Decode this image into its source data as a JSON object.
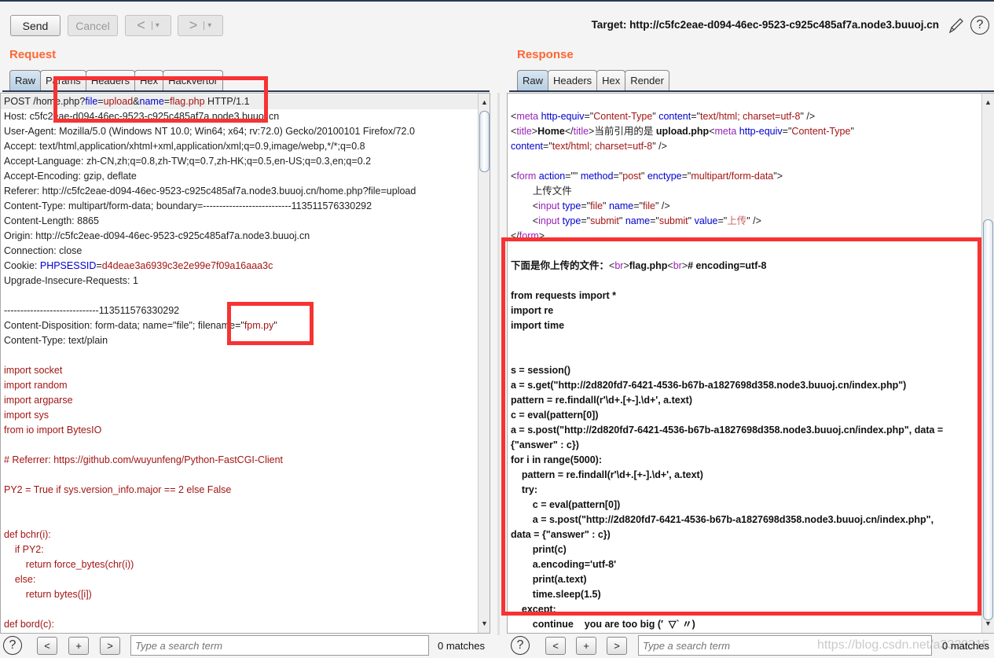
{
  "toolbar": {
    "send": "Send",
    "cancel": "Cancel",
    "back": "<",
    "back_menu": "▾",
    "forward": ">",
    "forward_menu": "▾",
    "target": "Target: http://c5fc2eae-d094-46ec-9523-c925c485af7a.node3.buuoj.cn",
    "edit_icon": "pencil-icon",
    "help_icon": "?"
  },
  "request": {
    "title": "Request",
    "tabs": [
      "Raw",
      "Params",
      "Headers",
      "Hex",
      "Hackvertor"
    ],
    "lines": [
      [
        [
          "t",
          "POST /home.php?"
        ],
        [
          "k",
          "file"
        ],
        [
          "t",
          "="
        ],
        [
          "v",
          "upload"
        ],
        [
          "t",
          "&"
        ],
        [
          "k",
          "name"
        ],
        [
          "t",
          "="
        ],
        [
          "v",
          "flag.php"
        ],
        [
          "t",
          " HTTP/1.1"
        ]
      ],
      [
        [
          "t",
          "Host: c5fc2eae-d094-46ec-9523-c925c485af7a.node3.buuoj.cn"
        ]
      ],
      [
        [
          "t",
          "User-Agent: Mozilla/5.0 (Windows NT 10.0; Win64; x64; rv:72.0) Gecko/20100101 Firefox/72.0"
        ]
      ],
      [
        [
          "t",
          "Accept: text/html,application/xhtml+xml,application/xml;q=0.9,image/webp,*/*;q=0.8"
        ]
      ],
      [
        [
          "t",
          "Accept-Language: zh-CN,zh;q=0.8,zh-TW;q=0.7,zh-HK;q=0.5,en-US;q=0.3,en;q=0.2"
        ]
      ],
      [
        [
          "t",
          "Accept-Encoding: gzip, deflate"
        ]
      ],
      [
        [
          "t",
          "Referer: http://c5fc2eae-d094-46ec-9523-c925c485af7a.node3.buuoj.cn/home.php?file=upload"
        ]
      ],
      [
        [
          "t",
          "Content-Type: multipart/form-data; boundary=---------------------------113511576330292"
        ]
      ],
      [
        [
          "t",
          "Content-Length: 8865"
        ]
      ],
      [
        [
          "t",
          "Origin: http://c5fc2eae-d094-46ec-9523-c925c485af7a.node3.buuoj.cn"
        ]
      ],
      [
        [
          "t",
          "Connection: close"
        ]
      ],
      [
        [
          "t",
          "Cookie: "
        ],
        [
          "k",
          "PHPSESSID"
        ],
        [
          "t",
          "="
        ],
        [
          "v",
          "d4deae3a6939c3e2e99e7f09a16aaa3c"
        ]
      ],
      [
        [
          "t",
          "Upgrade-Insecure-Requests: 1"
        ]
      ],
      [],
      [
        [
          "t",
          "-----------------------------113511576330292"
        ]
      ],
      [
        [
          "t",
          "Content-Disposition: form-data; name=\"file\"; filename=\""
        ],
        [
          "v",
          "fpm.py"
        ],
        [
          "t",
          "\""
        ]
      ],
      [
        [
          "t",
          "Content-Type: text/plain"
        ]
      ],
      [],
      [
        [
          "p",
          "import socket"
        ]
      ],
      [
        [
          "p",
          "import random"
        ]
      ],
      [
        [
          "p",
          "import argparse"
        ]
      ],
      [
        [
          "p",
          "import sys"
        ]
      ],
      [
        [
          "p",
          "from io import BytesIO"
        ]
      ],
      [],
      [
        [
          "p",
          "# Referrer: https://github.com/wuyunfeng/Python-FastCGI-Client"
        ]
      ],
      [],
      [
        [
          "p",
          "PY2 = True if sys.version_info.major == 2 else False"
        ]
      ],
      [],
      [],
      [
        [
          "p",
          "def bchr(i):"
        ]
      ],
      [
        [
          "p",
          "    if PY2:"
        ]
      ],
      [
        [
          "p",
          "        return force_bytes(chr(i))"
        ]
      ],
      [
        [
          "p",
          "    else:"
        ]
      ],
      [
        [
          "p",
          "        return bytes([i])"
        ]
      ],
      [],
      [
        [
          "p",
          "def bord(c):"
        ]
      ]
    ]
  },
  "response": {
    "title": "Response",
    "tabs": [
      "Raw",
      "Headers",
      "Hex",
      "Render"
    ],
    "lines": [
      [
        [
          "t",
          "<"
        ],
        [
          "g",
          "meta"
        ],
        [
          "k",
          " http-equiv"
        ],
        [
          "t",
          "=\""
        ],
        [
          "v",
          "Content-Type"
        ],
        [
          "t",
          "\" "
        ],
        [
          "k",
          "content"
        ],
        [
          "t",
          "=\""
        ],
        [
          "v",
          "text/html; charset=utf-8"
        ],
        [
          "t",
          "\" />"
        ]
      ],
      [
        [
          "t",
          "<"
        ],
        [
          "g",
          "title"
        ],
        [
          "t",
          ">"
        ],
        [
          "b",
          "Home"
        ],
        [
          "t",
          "</"
        ],
        [
          "g",
          "title"
        ],
        [
          "t",
          ">当前引用的是 "
        ],
        [
          "b",
          "upload.php"
        ],
        [
          "t",
          "<"
        ],
        [
          "g",
          "meta"
        ],
        [
          "k",
          " http-equiv"
        ],
        [
          "t",
          "=\""
        ],
        [
          "v",
          "Content-Type"
        ],
        [
          "t",
          "\""
        ]
      ],
      [
        [
          "k",
          "content"
        ],
        [
          "t",
          "=\""
        ],
        [
          "v",
          "text/html; charset=utf-8"
        ],
        [
          "t",
          "\" />"
        ]
      ],
      [],
      [
        [
          "t",
          "<"
        ],
        [
          "g",
          "form"
        ],
        [
          "k",
          " action"
        ],
        [
          "t",
          "=\"\" "
        ],
        [
          "k",
          "method"
        ],
        [
          "t",
          "=\""
        ],
        [
          "v",
          "post"
        ],
        [
          "t",
          "\" "
        ],
        [
          "k",
          "enctype"
        ],
        [
          "t",
          "=\""
        ],
        [
          "v",
          "multipart/form-data"
        ],
        [
          "t",
          "\">"
        ]
      ],
      [
        [
          "t",
          "        上传文件"
        ]
      ],
      [
        [
          "t",
          "        <"
        ],
        [
          "g",
          "input"
        ],
        [
          "k",
          " type"
        ],
        [
          "t",
          "=\""
        ],
        [
          "v",
          "file"
        ],
        [
          "t",
          "\" "
        ],
        [
          "k",
          "name"
        ],
        [
          "t",
          "=\""
        ],
        [
          "v",
          "file"
        ],
        [
          "t",
          "\" />"
        ]
      ],
      [
        [
          "t",
          "        <"
        ],
        [
          "g",
          "input"
        ],
        [
          "k",
          " type"
        ],
        [
          "t",
          "=\""
        ],
        [
          "v",
          "submit"
        ],
        [
          "t",
          "\" "
        ],
        [
          "k",
          "name"
        ],
        [
          "t",
          "=\""
        ],
        [
          "v",
          "submit"
        ],
        [
          "t",
          "\" "
        ],
        [
          "k",
          "value"
        ],
        [
          "t",
          "=\""
        ],
        [
          "lr",
          "上传"
        ],
        [
          "t",
          "\" />"
        ]
      ],
      [
        [
          "t",
          "</"
        ],
        [
          "g",
          "form"
        ],
        [
          "t",
          ">"
        ]
      ],
      [],
      [
        [
          "b",
          "下面是你上传的文件："
        ],
        [
          "t",
          "<"
        ],
        [
          "g",
          "br"
        ],
        [
          "t",
          ">"
        ],
        [
          "b",
          "flag.php"
        ],
        [
          "t",
          "<"
        ],
        [
          "g",
          "br"
        ],
        [
          "t",
          ">"
        ],
        [
          "b",
          "# encoding=utf-8"
        ]
      ],
      [],
      [
        [
          "b",
          "from requests import *"
        ]
      ],
      [
        [
          "b",
          "import re"
        ]
      ],
      [
        [
          "b",
          "import time"
        ]
      ],
      [],
      [],
      [
        [
          "b",
          "s = session()"
        ]
      ],
      [
        [
          "b",
          "a = s.get(\"http://2d820fd7-6421-4536-b67b-a1827698d358.node3.buuoj.cn/index.php\")"
        ]
      ],
      [
        [
          "b",
          "pattern = re.findall(r'\\d+.[+-].\\d+', a.text)"
        ]
      ],
      [
        [
          "b",
          "c = eval(pattern[0])"
        ]
      ],
      [
        [
          "b",
          "a = s.post(\"http://2d820fd7-6421-4536-b67b-a1827698d358.node3.buuoj.cn/index.php\", data ="
        ]
      ],
      [
        [
          "b",
          "{\"answer\" : c})"
        ]
      ],
      [
        [
          "b",
          "for i in range(5000):"
        ]
      ],
      [
        [
          "b",
          "    pattern = re.findall(r'\\d+.[+-].\\d+', a.text)"
        ]
      ],
      [
        [
          "b",
          "    try:"
        ]
      ],
      [
        [
          "b",
          "        c = eval(pattern[0])"
        ]
      ],
      [
        [
          "b",
          "        a = s.post(\"http://2d820fd7-6421-4536-b67b-a1827698d358.node3.buuoj.cn/index.php\","
        ]
      ],
      [
        [
          "b",
          "data = {\"answer\" : c})"
        ]
      ],
      [
        [
          "b",
          "        print(c)"
        ]
      ],
      [
        [
          "b",
          "        a.encoding='utf-8'"
        ]
      ],
      [
        [
          "b",
          "        print(a.text)"
        ]
      ],
      [
        [
          "b",
          "        time.sleep(1.5)"
        ]
      ],
      [
        [
          "b",
          "    except:"
        ]
      ],
      [
        [
          "b",
          "        continue    you are too big (′  ▽` 〃)"
        ]
      ]
    ]
  },
  "search": {
    "placeholder": "Type a search term",
    "prev": "<",
    "add": "+",
    "next": ">",
    "help": "?",
    "request_matches": "0 matches",
    "response_matches": "0 matches"
  },
  "watermark": "https://blog.csdn.net/a3320315",
  "colors": {
    "accent": "#ff6633",
    "highlight_box": "#f83232",
    "key": "#0000cc",
    "value": "#a31515",
    "tag": "#9a22b8"
  }
}
